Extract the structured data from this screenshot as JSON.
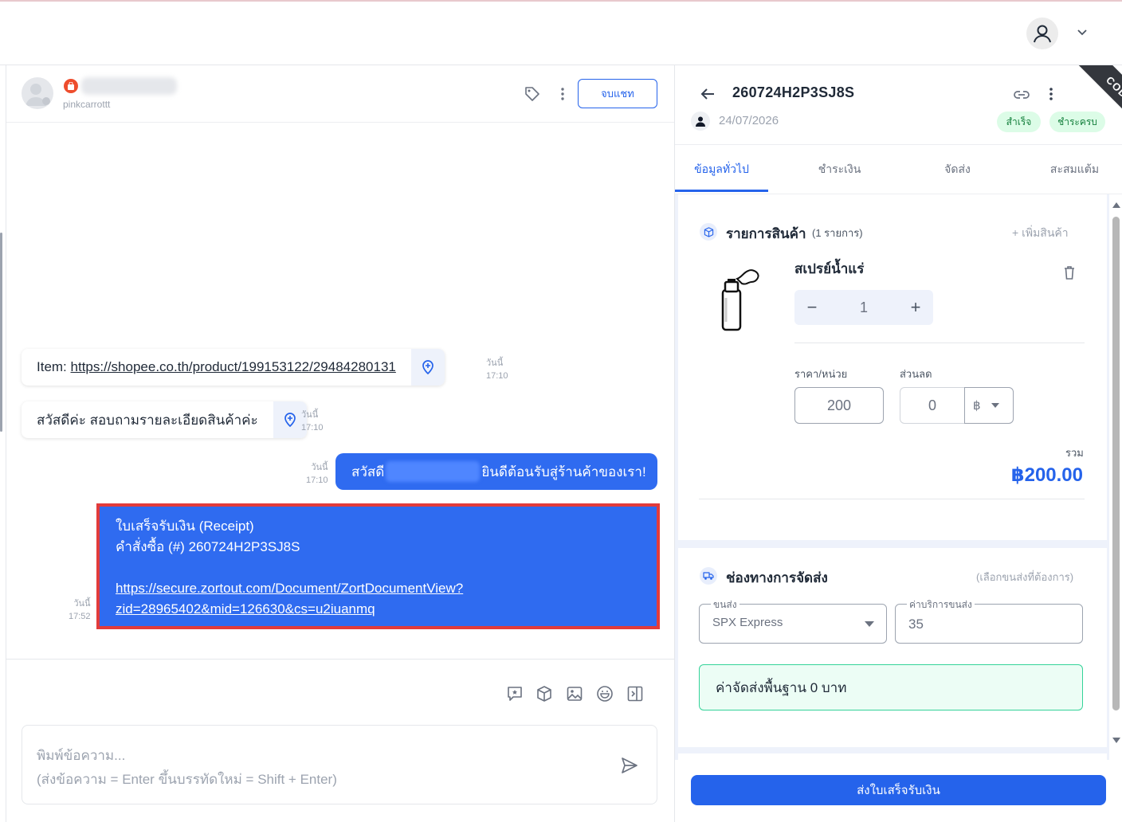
{
  "colors": {
    "primary": "#2563eb",
    "bubble": "#2f6bf0",
    "highlight_border": "#e23b3b",
    "success_bg": "#dcfce7",
    "success_text": "#15803d",
    "notice_bg": "#ecfdf5"
  },
  "topbar": {
    "avatar_icon": "user-icon",
    "menu_icon": "chevron-down-icon"
  },
  "chat": {
    "header": {
      "username": "pinkcarrottt",
      "channel_icon": "shopee-bag-icon",
      "end_chat_label": "จบแชท"
    },
    "messages": [
      {
        "direction": "in",
        "prefix": "Item: ",
        "link": "https://shopee.co.th/product/199153122/29484280131",
        "day": "วันนี้",
        "time": "17:10"
      },
      {
        "direction": "in",
        "text": "สวัสดีค่ะ สอบถามรายละเอียดสินค้าค่ะ",
        "day": "วันนี้",
        "time": "17:10"
      },
      {
        "direction": "out",
        "text_before": "สวัสดี",
        "text_after": "ยินดีต้อนรับสู่ร้านค้าของเรา!",
        "day": "วันนี้",
        "time": "17:10"
      },
      {
        "direction": "out",
        "line1": "ใบเสร็จรับเงิน (Receipt)",
        "line2": "คำสั่งซื้อ (#) 260724H2P3SJ8S",
        "link_line1": "https://secure.zortout.com/Document/ZortDocumentView?",
        "link_line2": "zid=28965402&mid=126630&cs=u2iuanmq",
        "day": "วันนี้",
        "time": "17:52"
      }
    ],
    "composer": {
      "placeholder_line1": "พิมพ์ข้อความ...",
      "placeholder_line2": "(ส่งข้อความ = Enter ขึ้นบรรทัดใหม่ = Shift + Enter)"
    }
  },
  "order": {
    "id": "260724H2P3SJ8S",
    "date": "24/07/2026",
    "ribbon": "COD",
    "status_badges": [
      "สำเร็จ",
      "ชำระครบ"
    ],
    "tabs": [
      "ข้อมูลทั่วไป",
      "ชำระเงิน",
      "จัดส่ง",
      "สะสมแต้ม"
    ],
    "active_tab": "ข้อมูลทั่วไป",
    "products": {
      "title": "รายการสินค้า",
      "count_text": "(1 รายการ)",
      "add_label": "+ เพิ่มสินค้า",
      "item": {
        "name": "สเปรย์น้ำแร่",
        "quantity": "1",
        "price_label": "ราคา/หน่วย",
        "price": "200",
        "discount_label": "ส่วนลด",
        "discount": "0",
        "discount_unit": "฿",
        "total_label": "รวม",
        "total": "฿200.00"
      }
    },
    "shipping": {
      "title": "ช่องทางการจัดส่ง",
      "hint": "(เลือกขนส่งที่ต้องการ)",
      "carrier_label": "ขนส่ง",
      "carrier": "SPX Express",
      "fee_label": "ค่าบริการขนส่ง",
      "fee": "35",
      "notice": "ค่าจัดส่งพื้นฐาน 0 บาท"
    },
    "send_receipt_label": "ส่งใบเสร็จรับเงิน"
  }
}
